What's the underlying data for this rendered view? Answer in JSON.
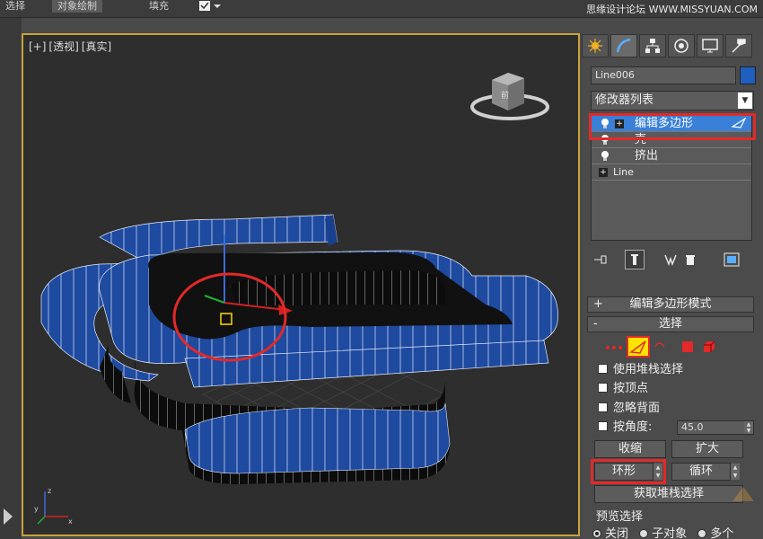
{
  "topbar": {
    "tabs": [
      "选择",
      "对象绘制",
      "填充"
    ],
    "watermark": "思缘设计论坛 WWW.MISSYUAN.COM"
  },
  "viewport": {
    "label_plus": "[+]",
    "label_view": "[透视]",
    "label_shade": "[真实]"
  },
  "panel": {
    "tabs": [
      "create-icon",
      "modify-icon",
      "hierarchy-icon",
      "motion-icon",
      "display-icon",
      "utilities-icon"
    ],
    "object_name": "Line006",
    "object_color": "#1f5fbf",
    "modifier_list": "修改器列表",
    "stack": [
      {
        "label": "编辑多边形",
        "selected": true
      },
      {
        "label": "壳",
        "selected": false
      },
      {
        "label": "挤出",
        "selected": false
      },
      {
        "label": "Line",
        "selected": false
      }
    ],
    "rollout_editpoly_mode": "编辑多边形模式",
    "rollout_selection": "选择",
    "options": {
      "use_stack": "使用堆栈选择",
      "by_vertex": "按顶点",
      "ignore_back": "忽略背面",
      "by_angle": "按角度:",
      "angle_value": "45.0"
    },
    "buttons": {
      "shrink": "收缩",
      "grow": "扩大",
      "ring": "环形",
      "loop": "循环",
      "get_stack": "获取堆栈选择"
    },
    "preview": {
      "title": "预览选择",
      "off": "关闭",
      "subobject": "子对象",
      "multi": "多个"
    },
    "rollout_plus": "+",
    "rollout_minus": "-"
  }
}
